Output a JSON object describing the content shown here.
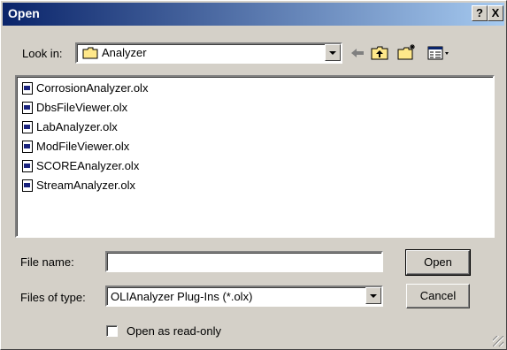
{
  "window": {
    "title": "Open",
    "help_label": "?",
    "close_label": "X"
  },
  "lookin": {
    "label": "Look in:",
    "value": "Analyzer"
  },
  "files": [
    {
      "name": "CorrosionAnalyzer.olx"
    },
    {
      "name": "DbsFileViewer.olx"
    },
    {
      "name": "LabAnalyzer.olx"
    },
    {
      "name": "ModFileViewer.olx"
    },
    {
      "name": "SCOREAnalyzer.olx"
    },
    {
      "name": "StreamAnalyzer.olx"
    }
  ],
  "filename": {
    "label": "File name:",
    "value": ""
  },
  "filetype": {
    "label": "Files of type:",
    "value": "OLIAnalyzer Plug-Ins (*.olx)"
  },
  "buttons": {
    "open": "Open",
    "cancel": "Cancel"
  },
  "readonly": {
    "label": "Open as read-only",
    "checked": false
  },
  "icons": [
    "back-icon",
    "up-folder-icon",
    "new-folder-icon",
    "view-menu-icon",
    "folder-icon",
    "file-icon"
  ]
}
